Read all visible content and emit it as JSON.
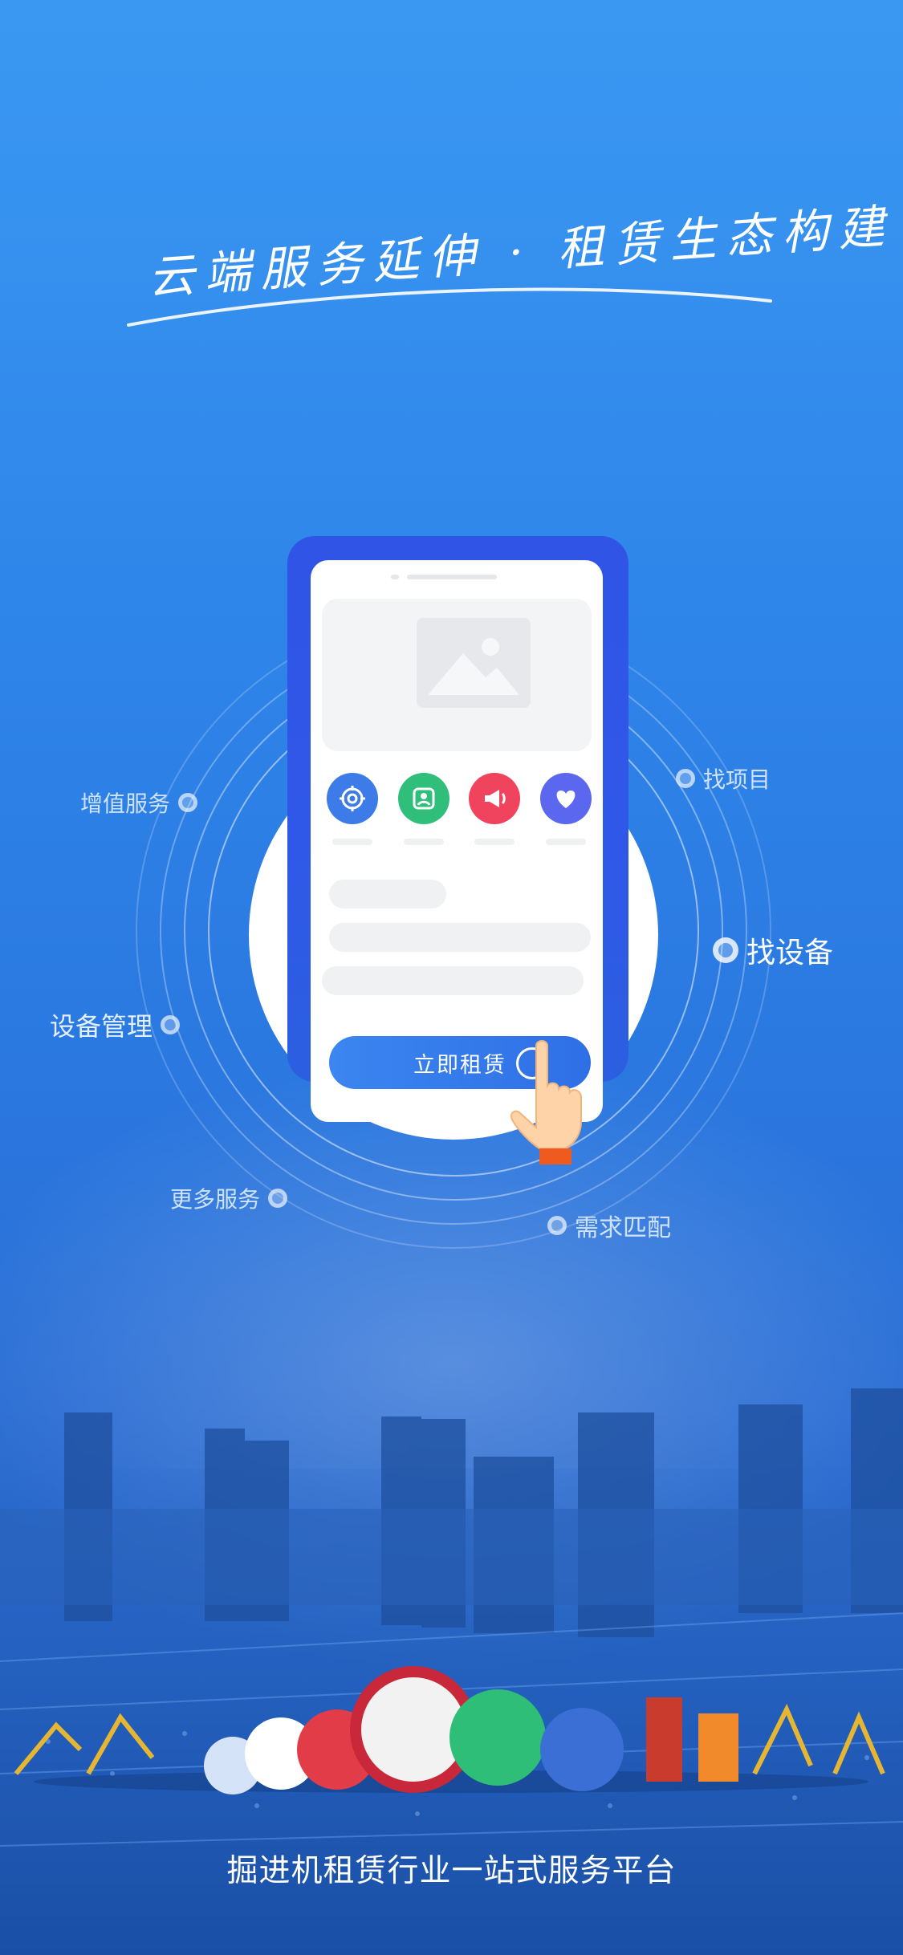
{
  "slogan": "云端服务延伸 · 租赁生态构建",
  "orbit_labels": {
    "value_added": "增值服务",
    "find_project": "找项目",
    "find_equipment": "找设备",
    "equipment_mgmt": "设备管理",
    "more_services": "更多服务",
    "demand_match": "需求匹配"
  },
  "phone": {
    "rent_button": "立即租赁",
    "quick_icons": [
      "settings-gear-icon",
      "contacts-icon",
      "megaphone-icon",
      "heart-icon"
    ],
    "quick_icon_colors": [
      "#3c7be8",
      "#2fbf7b",
      "#f0445e",
      "#5b67ef"
    ]
  },
  "footer": {
    "tagline": "掘进机租赁行业一站式服务平台"
  },
  "colors": {
    "bg_top": "#3a98f2",
    "bg_bottom": "#1b4fa5",
    "phone_frame": "#2f54e6",
    "accent_blue": "#3b86f0"
  }
}
